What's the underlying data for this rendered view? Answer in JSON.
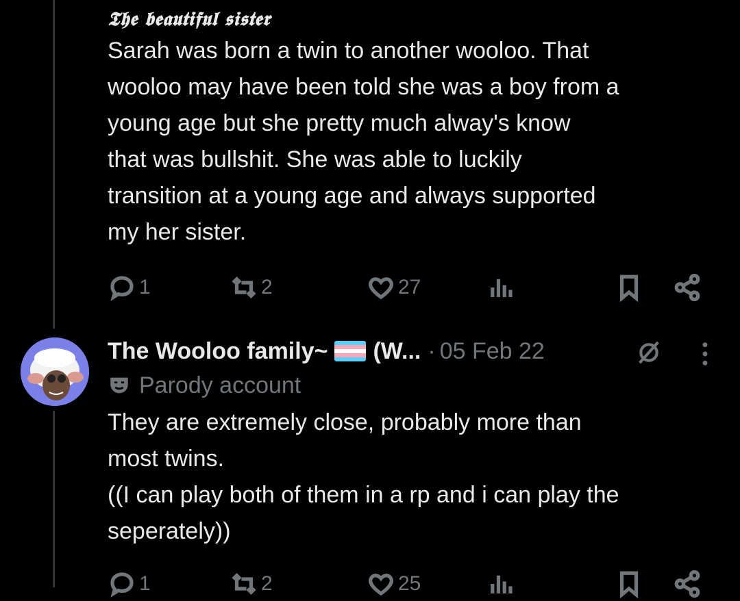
{
  "tweet1": {
    "title": "𝕿𝖍𝖊 𝖇𝖊𝖆𝖚𝖙𝖎𝖋𝖚𝖑 𝖘𝖎𝖘𝖙𝖊𝖗",
    "body": "Sarah was born a twin to another wooloo. That\nwooloo may have been told she was a boy from a\nyoung age but she pretty much alway's know\nthat was bullshit. She was able to luckily\ntransition at a young age and always supported\nmy her sister.",
    "actions": {
      "reply_count": "1",
      "retweet_count": "2",
      "like_count": "27",
      "views_count": ""
    }
  },
  "tweet2": {
    "display_name": "The Wooloo family~",
    "flag_icon": "trans-flag",
    "name_tail": "(W...",
    "separator": "·",
    "date": "05 Feb 22",
    "parody_label": "Parody account",
    "body": "They are extremely close, probably more than\nmost twins.\n((I can play both of them in a rp and i can play the\nseperately))",
    "actions": {
      "reply_count": "1",
      "retweet_count": "2",
      "like_count": "25",
      "views_count": ""
    }
  },
  "colors": {
    "background": "#000000",
    "text": "#e7e9ea",
    "muted": "#71767b",
    "thread_line": "#333639",
    "trans_blue": "#5BCEFA",
    "trans_pink": "#F5A9B8",
    "trans_white": "#FFFFFF"
  },
  "icons": [
    "reply-icon",
    "retweet-icon",
    "like-icon",
    "views-icon",
    "bookmark-icon",
    "share-icon",
    "grok-icon",
    "more-icon",
    "parody-mask-icon"
  ]
}
